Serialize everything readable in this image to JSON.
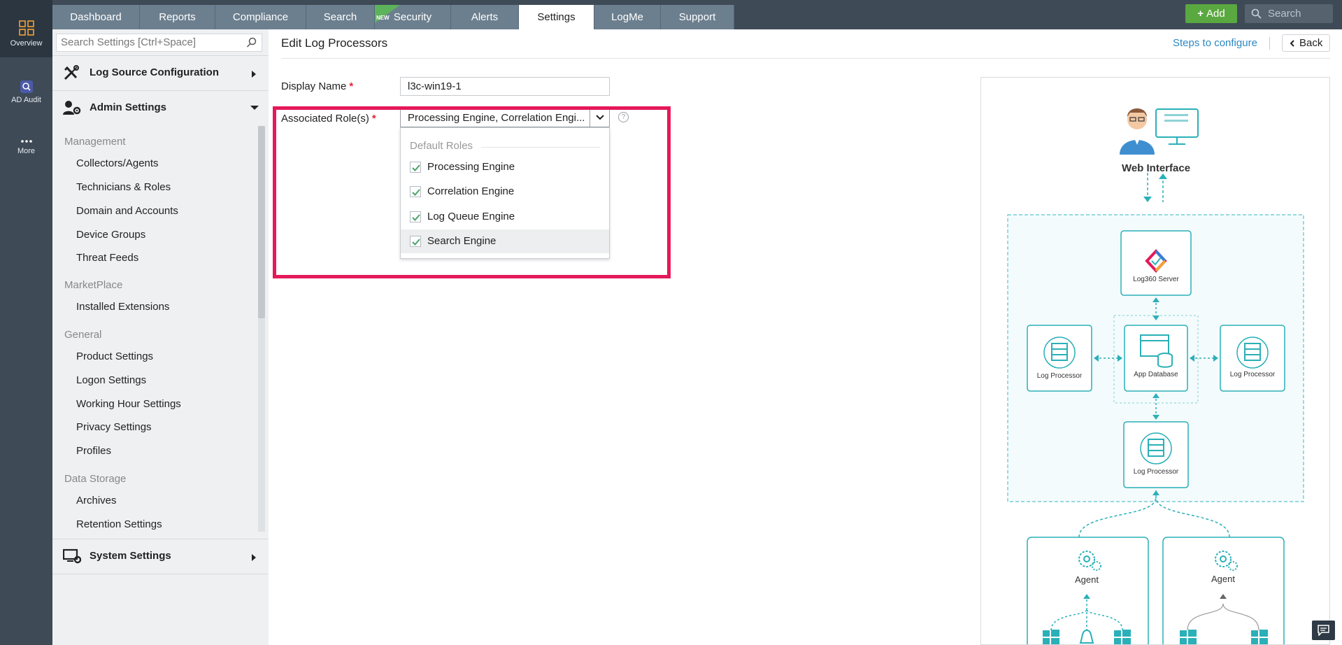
{
  "rail": {
    "items": [
      {
        "label": "Overview",
        "icon": "overview-grid-icon"
      },
      {
        "label": "AD Audit",
        "icon": "ad-audit-icon"
      },
      {
        "label": "More",
        "icon": "more-dots-icon"
      }
    ]
  },
  "topbar": {
    "tabs": [
      {
        "label": "Dashboard"
      },
      {
        "label": "Reports"
      },
      {
        "label": "Compliance"
      },
      {
        "label": "Search"
      },
      {
        "label": "Security",
        "badge": "NEW"
      },
      {
        "label": "Alerts"
      },
      {
        "label": "Settings",
        "active": true
      },
      {
        "label": "LogMe"
      },
      {
        "label": "Support"
      }
    ],
    "add_label": "Add",
    "search_placeholder": "Search"
  },
  "sidebar": {
    "search_placeholder": "Search Settings [Ctrl+Space]",
    "sections": {
      "log_source": "Log Source Configuration",
      "admin": "Admin Settings",
      "system": "System Settings"
    },
    "groups": {
      "management": "Management",
      "marketplace": "MarketPlace",
      "general": "General",
      "data_storage": "Data Storage"
    },
    "items": {
      "collectors": "Collectors/Agents",
      "technicians": "Technicians & Roles",
      "domain": "Domain and Accounts",
      "device_groups": "Device Groups",
      "threat_feeds": "Threat Feeds",
      "installed_ext": "Installed Extensions",
      "product_settings": "Product Settings",
      "logon_settings": "Logon Settings",
      "working_hour": "Working Hour Settings",
      "privacy": "Privacy Settings",
      "profiles": "Profiles",
      "archives": "Archives",
      "retention": "Retention Settings"
    }
  },
  "main": {
    "title": "Edit Log Processors",
    "steps_link": "Steps to configure",
    "back_label": "Back",
    "display_name_label": "Display Name",
    "display_name_value": "l3c-win19-1",
    "roles_label": "Associated Role(s)",
    "roles_value": "Processing Engine, Correlation Engi...",
    "help": "?",
    "required_mark": "*",
    "dropdown": {
      "group": "Default Roles",
      "options": [
        {
          "label": "Processing Engine",
          "checked": true
        },
        {
          "label": "Correlation Engine",
          "checked": true
        },
        {
          "label": "Log Queue Engine",
          "checked": true
        },
        {
          "label": "Search Engine",
          "checked": true
        }
      ]
    }
  },
  "diagram": {
    "web_interface": "Web Interface",
    "server": "Log360 Server",
    "log_processor": "Log Processor",
    "app_database": "App Database",
    "agent": "Agent"
  },
  "colors": {
    "highlight": "#e5185a",
    "teal": "#2ab0b8",
    "add_green": "#5aa840",
    "link_blue": "#2d87c3"
  }
}
